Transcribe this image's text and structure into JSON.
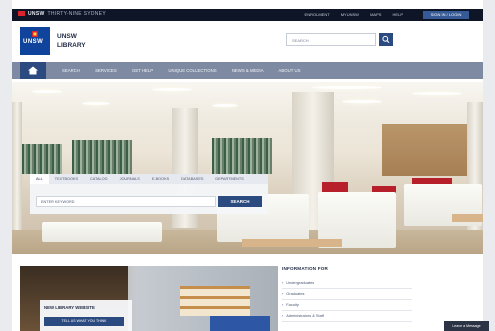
{
  "topbar": {
    "brand": "UNSW",
    "tagline": "THIRTY-NINE SYDNEY",
    "links": [
      "ENROLMENT",
      "MYUNSW",
      "MAPS",
      "HELP"
    ],
    "button": "SIGN IN / LOGIN"
  },
  "header": {
    "logo_text": "UNSW",
    "library_line1": "UNSW",
    "library_line2": "LIBRARY",
    "search_placeholder": "SEARCH"
  },
  "nav": {
    "items": [
      "SEARCH",
      "SERVICES",
      "GET HELP",
      "UNIQUE COLLECTIONS",
      "NEWS & MEDIA",
      "ABOUT US"
    ]
  },
  "search_widget": {
    "tabs": [
      "ALL",
      "TEXTBOOKS",
      "CATALOG",
      "JOURNALS",
      "E-BOOKS",
      "DATABASES",
      "DEPARTMENTS"
    ],
    "active_tab": "ALL",
    "input_placeholder": "ENTER KEYWORD",
    "button": "SEARCH"
  },
  "promo": {
    "title": "NEW LIBRARY WEBSITE",
    "button": "TELL US WHAT YOU THINK"
  },
  "info": {
    "heading": "INFORMATION FOR",
    "items": [
      "Undergraduates",
      "Graduates",
      "Faculty",
      "Administrators & Staff"
    ]
  },
  "chat": {
    "label": "Leave a Message"
  },
  "colors": {
    "primary": "#2a4a80",
    "nav": "#7d8aa2",
    "topbar": "#0d1526"
  }
}
